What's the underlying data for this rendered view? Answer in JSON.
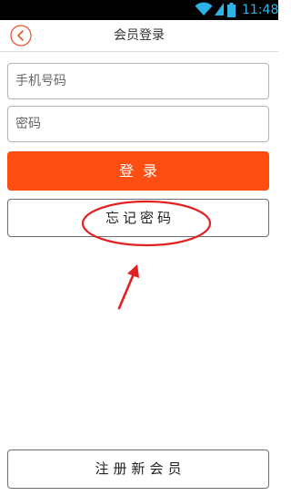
{
  "status_bar": {
    "time": "11:48",
    "icons": [
      "wifi-icon",
      "signal-icon",
      "battery-icon"
    ],
    "accent_color": "#2fb3e6"
  },
  "header": {
    "title": "会员登录",
    "back_icon": "back-arrow-icon"
  },
  "form": {
    "phone_placeholder": "手机号码",
    "password_placeholder": "密码"
  },
  "buttons": {
    "login_label": "登录",
    "forgot_label": "忘记密码",
    "register_label": "注册新会员"
  },
  "colors": {
    "login_button": "#ff4e12",
    "annotation": "#e32020"
  }
}
